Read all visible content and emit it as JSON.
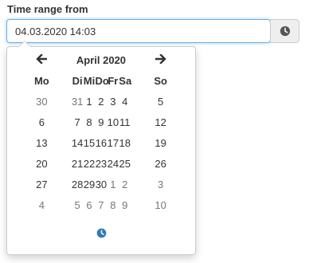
{
  "field": {
    "label": "Time range from",
    "value": "04.03.2020 14:03"
  },
  "addon": {
    "icon": "clock-icon"
  },
  "calendar": {
    "month_label": "April 2020",
    "prev_icon": "arrow-left-icon",
    "next_icon": "arrow-right-icon",
    "weekdays": [
      "Mo",
      "Di",
      "Mi",
      "Do",
      "Fr",
      "Sa",
      "So"
    ],
    "weeks": [
      [
        {
          "d": "30",
          "o": true
        },
        {
          "d": "31",
          "o": true
        },
        {
          "d": "1",
          "o": false
        },
        {
          "d": "2",
          "o": false
        },
        {
          "d": "3",
          "o": false
        },
        {
          "d": "4",
          "o": false
        },
        {
          "d": "5",
          "o": false
        }
      ],
      [
        {
          "d": "6",
          "o": false
        },
        {
          "d": "7",
          "o": false
        },
        {
          "d": "8",
          "o": false
        },
        {
          "d": "9",
          "o": false
        },
        {
          "d": "10",
          "o": false
        },
        {
          "d": "11",
          "o": false
        },
        {
          "d": "12",
          "o": false
        }
      ],
      [
        {
          "d": "13",
          "o": false
        },
        {
          "d": "14",
          "o": false
        },
        {
          "d": "15",
          "o": false
        },
        {
          "d": "16",
          "o": false
        },
        {
          "d": "17",
          "o": false
        },
        {
          "d": "18",
          "o": false
        },
        {
          "d": "19",
          "o": false
        }
      ],
      [
        {
          "d": "20",
          "o": false
        },
        {
          "d": "21",
          "o": false
        },
        {
          "d": "22",
          "o": false
        },
        {
          "d": "23",
          "o": false
        },
        {
          "d": "24",
          "o": false
        },
        {
          "d": "25",
          "o": false
        },
        {
          "d": "26",
          "o": false
        }
      ],
      [
        {
          "d": "27",
          "o": false
        },
        {
          "d": "28",
          "o": false
        },
        {
          "d": "29",
          "o": false
        },
        {
          "d": "30",
          "o": false
        },
        {
          "d": "1",
          "o": true
        },
        {
          "d": "2",
          "o": true
        },
        {
          "d": "3",
          "o": true
        }
      ],
      [
        {
          "d": "4",
          "o": true
        },
        {
          "d": "5",
          "o": true
        },
        {
          "d": "6",
          "o": true
        },
        {
          "d": "7",
          "o": true
        },
        {
          "d": "8",
          "o": true
        },
        {
          "d": "9",
          "o": true
        },
        {
          "d": "10",
          "o": true
        }
      ]
    ],
    "time_toggle_icon": "clock-icon"
  },
  "colors": {
    "accent": "#337ab7",
    "focus_border": "#66afe9",
    "muted_day": "#777777"
  }
}
